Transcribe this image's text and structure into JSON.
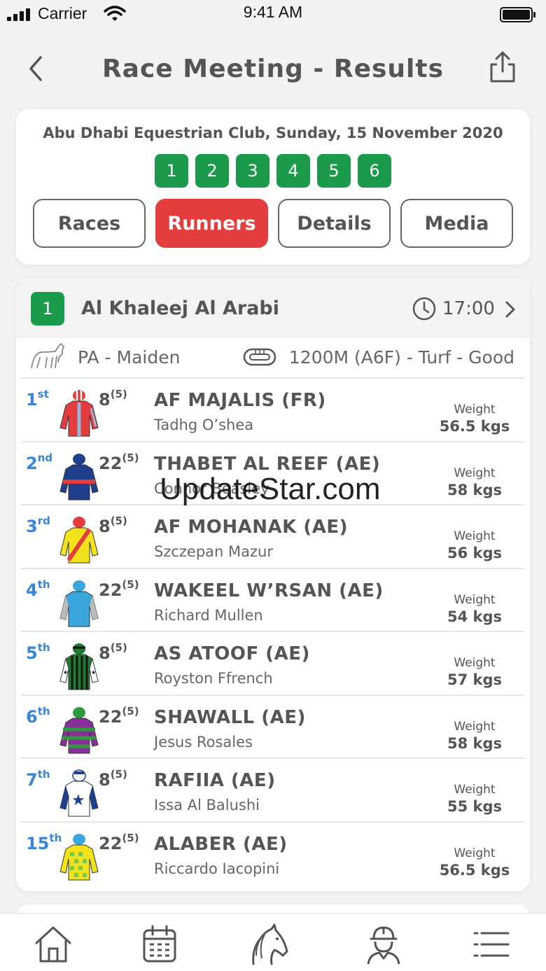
{
  "status_bar": {
    "carrier": "Carrier",
    "time": "9:41 AM"
  },
  "nav": {
    "title": "Race Meeting - Results",
    "back_icon": "chevron-left-icon",
    "share_icon": "share-icon"
  },
  "meeting": {
    "title": "Abu Dhabi Equestrian Club, Sunday, 15 November 2020",
    "race_numbers": [
      "1",
      "2",
      "3",
      "4",
      "5",
      "6"
    ],
    "tabs": [
      {
        "label": "Races",
        "active": false
      },
      {
        "label": "Runners",
        "active": true
      },
      {
        "label": "Details",
        "active": false
      },
      {
        "label": "Media",
        "active": false
      }
    ]
  },
  "race": {
    "number": "1",
    "name": "Al Khaleej Al Arabi",
    "time": "17:00",
    "type": "PA - Maiden",
    "distance": "1200M (A6F) - Turf - Good"
  },
  "runners": [
    {
      "pos": "1",
      "pos_suffix": "st",
      "draw": "8",
      "draw_sup": "(5)",
      "horse": "AF MAJALIS (FR)",
      "jockey": "Tadhg O’shea",
      "weight_label": "Weight",
      "weight": "56.5 kgs"
    },
    {
      "pos": "2",
      "pos_suffix": "nd",
      "draw": "22",
      "draw_sup": "(5)",
      "horse": "THABET AL REEF (AE)",
      "jockey": "Connor Beasley",
      "weight_label": "Weight",
      "weight": "58 kgs"
    },
    {
      "pos": "3",
      "pos_suffix": "rd",
      "draw": "8",
      "draw_sup": "(5)",
      "horse": "AF MOHANAK (AE)",
      "jockey": "Szczepan Mazur",
      "weight_label": "Weight",
      "weight": "56 kgs"
    },
    {
      "pos": "4",
      "pos_suffix": "th",
      "draw": "22",
      "draw_sup": "(5)",
      "horse": "WAKEEL W’RSAN (AE)",
      "jockey": "Richard Mullen",
      "weight_label": "Weight",
      "weight": "54 kgs"
    },
    {
      "pos": "5",
      "pos_suffix": "th",
      "draw": "8",
      "draw_sup": "(5)",
      "horse": "AS ATOOF (AE)",
      "jockey": "Royston Ffrench",
      "weight_label": "Weight",
      "weight": "57 kgs"
    },
    {
      "pos": "6",
      "pos_suffix": "th",
      "draw": "22",
      "draw_sup": "(5)",
      "horse": "SHAWALL (AE)",
      "jockey": "Jesus Rosales",
      "weight_label": "Weight",
      "weight": "58 kgs"
    },
    {
      "pos": "7",
      "pos_suffix": "th",
      "draw": "8",
      "draw_sup": "(5)",
      "horse": "RAFIIA (AE)",
      "jockey": "Issa Al Balushi",
      "weight_label": "Weight",
      "weight": "55 kgs"
    },
    {
      "pos": "15",
      "pos_suffix": "th",
      "draw": "22",
      "draw_sup": "(5)",
      "horse": "ALABER (AE)",
      "jockey": "Riccardo Iacopini",
      "weight_label": "Weight",
      "weight": "56.5 kgs"
    }
  ],
  "watermark": "UpdateStar.com",
  "tabbar_icons": [
    "home-icon",
    "calendar-icon",
    "horse-head-icon",
    "jockey-icon",
    "menu-icon"
  ],
  "colors": {
    "green": "#1a9a4a",
    "red": "#e33d3d",
    "blue": "#3a86d6"
  }
}
